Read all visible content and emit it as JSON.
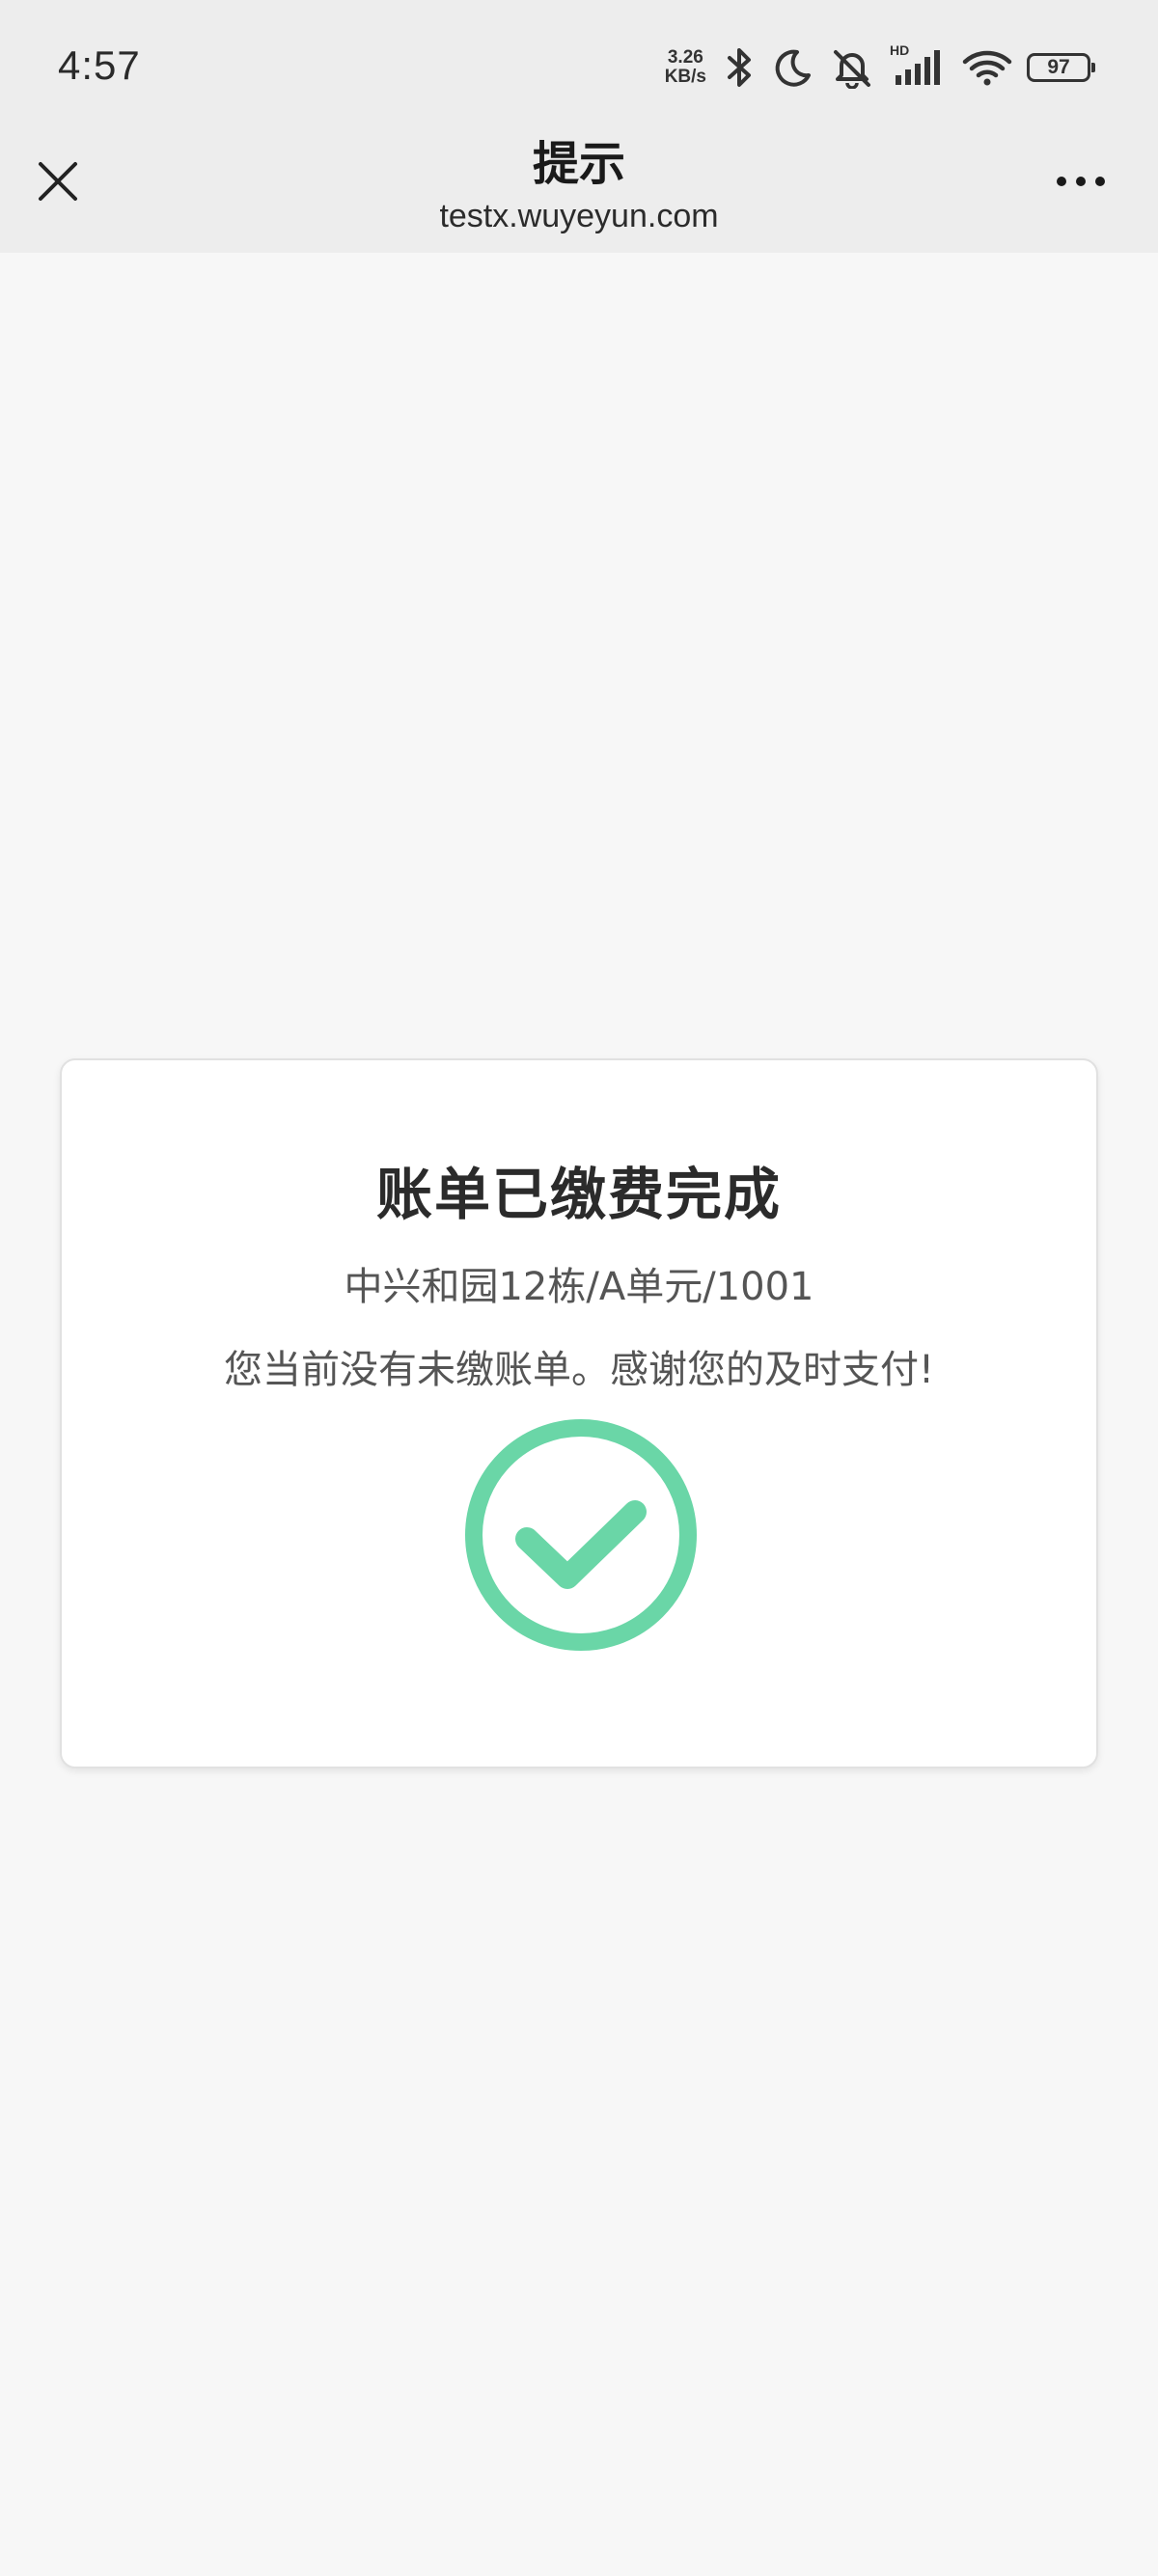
{
  "status_bar": {
    "time": "4:57",
    "net_speed_value": "3.26",
    "net_speed_unit": "KB/s",
    "network_label": "HD",
    "battery_level": "97",
    "icons": [
      "bluetooth-icon",
      "moon-icon",
      "mute-bell-icon",
      "signal-icon",
      "wifi-icon",
      "battery-icon"
    ]
  },
  "header": {
    "title": "提示",
    "domain": "testx.wuyeyun.com",
    "icons": [
      "close-icon",
      "more-icon"
    ]
  },
  "card": {
    "title": "账单已缴费完成",
    "address": "中兴和园12栋/A单元/1001",
    "message": "您当前没有未缴账单。感谢您的及时支付!",
    "icon": "check-circle-icon",
    "accent_color": "#6ad6a7"
  }
}
